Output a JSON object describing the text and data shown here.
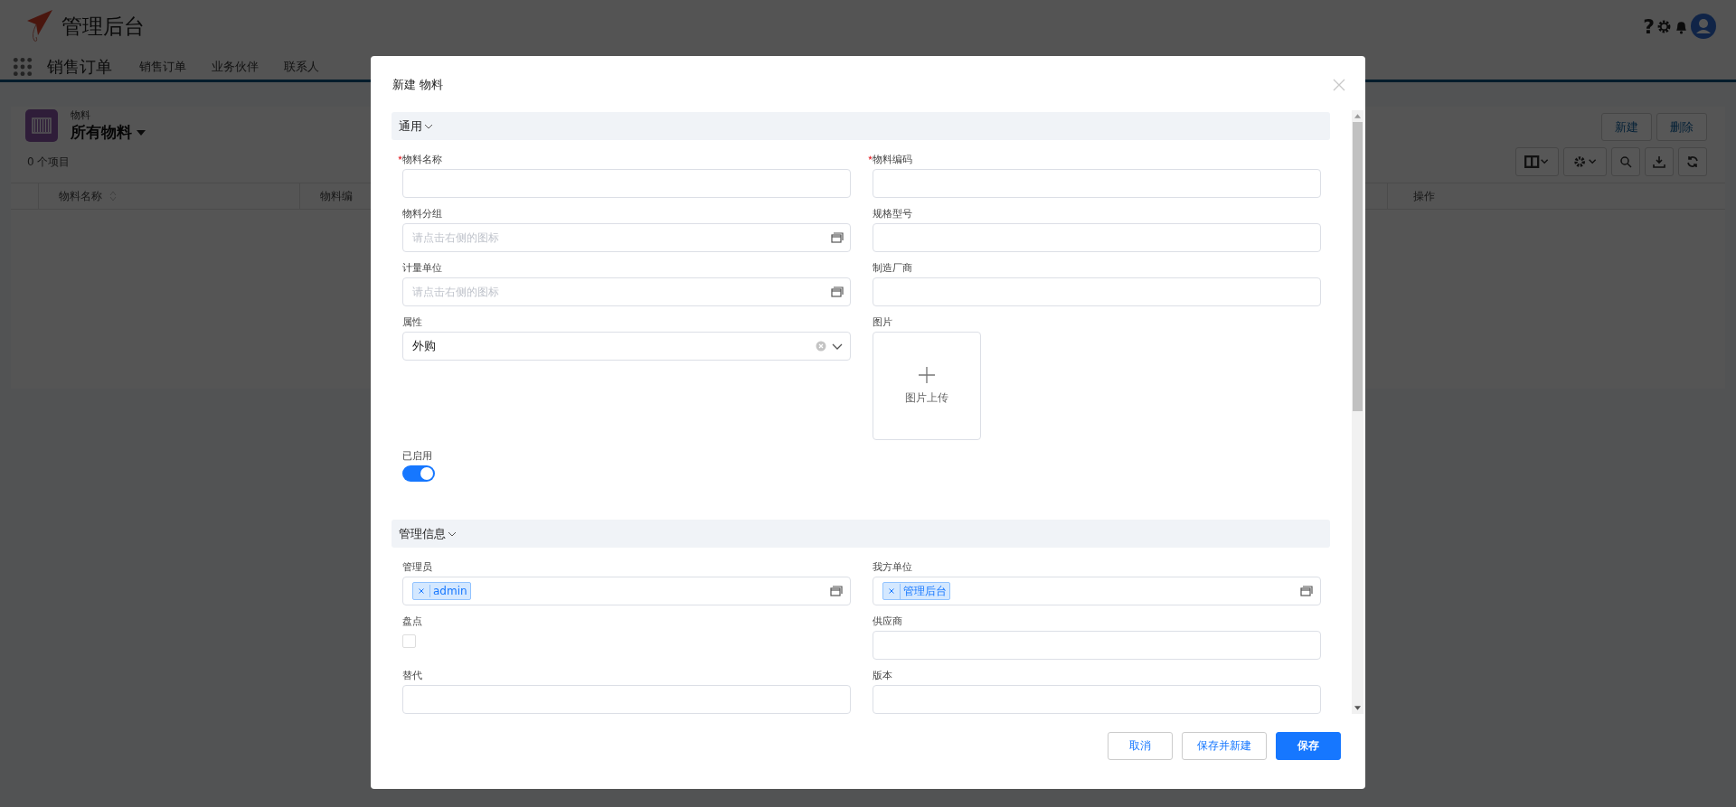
{
  "header": {
    "title": "管理后台",
    "help": "?"
  },
  "nav": {
    "app_title": "销售订单",
    "tabs": [
      {
        "label": "销售订单"
      },
      {
        "label": "业务伙伴"
      },
      {
        "label": "联系人"
      }
    ]
  },
  "list": {
    "object_label": "物料",
    "view_title": "所有物料",
    "count": "0 个项目",
    "buttons": [
      "新建",
      "删除"
    ],
    "columns": [
      {
        "label": "物料名称",
        "sortable": true
      },
      {
        "label": "物料编",
        "sortable": false
      },
      {
        "label": "操作",
        "sortable": false
      }
    ]
  },
  "dialog": {
    "title": "新建 物料",
    "sections": [
      {
        "title": "通用",
        "fields": [
          {
            "kind": "text",
            "label": "物料名称",
            "required": true
          },
          {
            "kind": "text",
            "label": "物料编码",
            "required": true
          },
          {
            "kind": "lookup",
            "label": "物料分组",
            "required": false,
            "placeholder": "请点击右侧的图标"
          },
          {
            "kind": "text",
            "label": "规格型号",
            "required": false
          },
          {
            "kind": "lookup",
            "label": "计量单位",
            "required": false,
            "placeholder": "请点击右侧的图标"
          },
          {
            "kind": "text",
            "label": "制造厂商",
            "required": false
          },
          {
            "kind": "select",
            "label": "属性",
            "required": false,
            "value": "外购"
          },
          {
            "kind": "image",
            "label": "图片",
            "required": false,
            "upload": "图片上传"
          },
          {
            "kind": "switch",
            "label": "已启用",
            "required": false,
            "on": true
          }
        ]
      },
      {
        "title": "管理信息",
        "fields": [
          {
            "kind": "tags",
            "label": "管理员",
            "required": false,
            "tags": [
              "admin"
            ]
          },
          {
            "kind": "tags",
            "label": "我方单位",
            "required": false,
            "tags": [
              "管理后台"
            ]
          },
          {
            "kind": "checkbox",
            "label": "盘点",
            "required": false,
            "checked": false
          },
          {
            "kind": "text",
            "label": "供应商",
            "required": false
          },
          {
            "kind": "text",
            "label": "替代",
            "required": false
          },
          {
            "kind": "text",
            "label": "版本",
            "required": false
          }
        ]
      }
    ],
    "buttons": [
      {
        "label": "取消",
        "kind": "default"
      },
      {
        "label": "保存并新建",
        "kind": "default"
      },
      {
        "label": "保存",
        "kind": "primary"
      }
    ]
  }
}
